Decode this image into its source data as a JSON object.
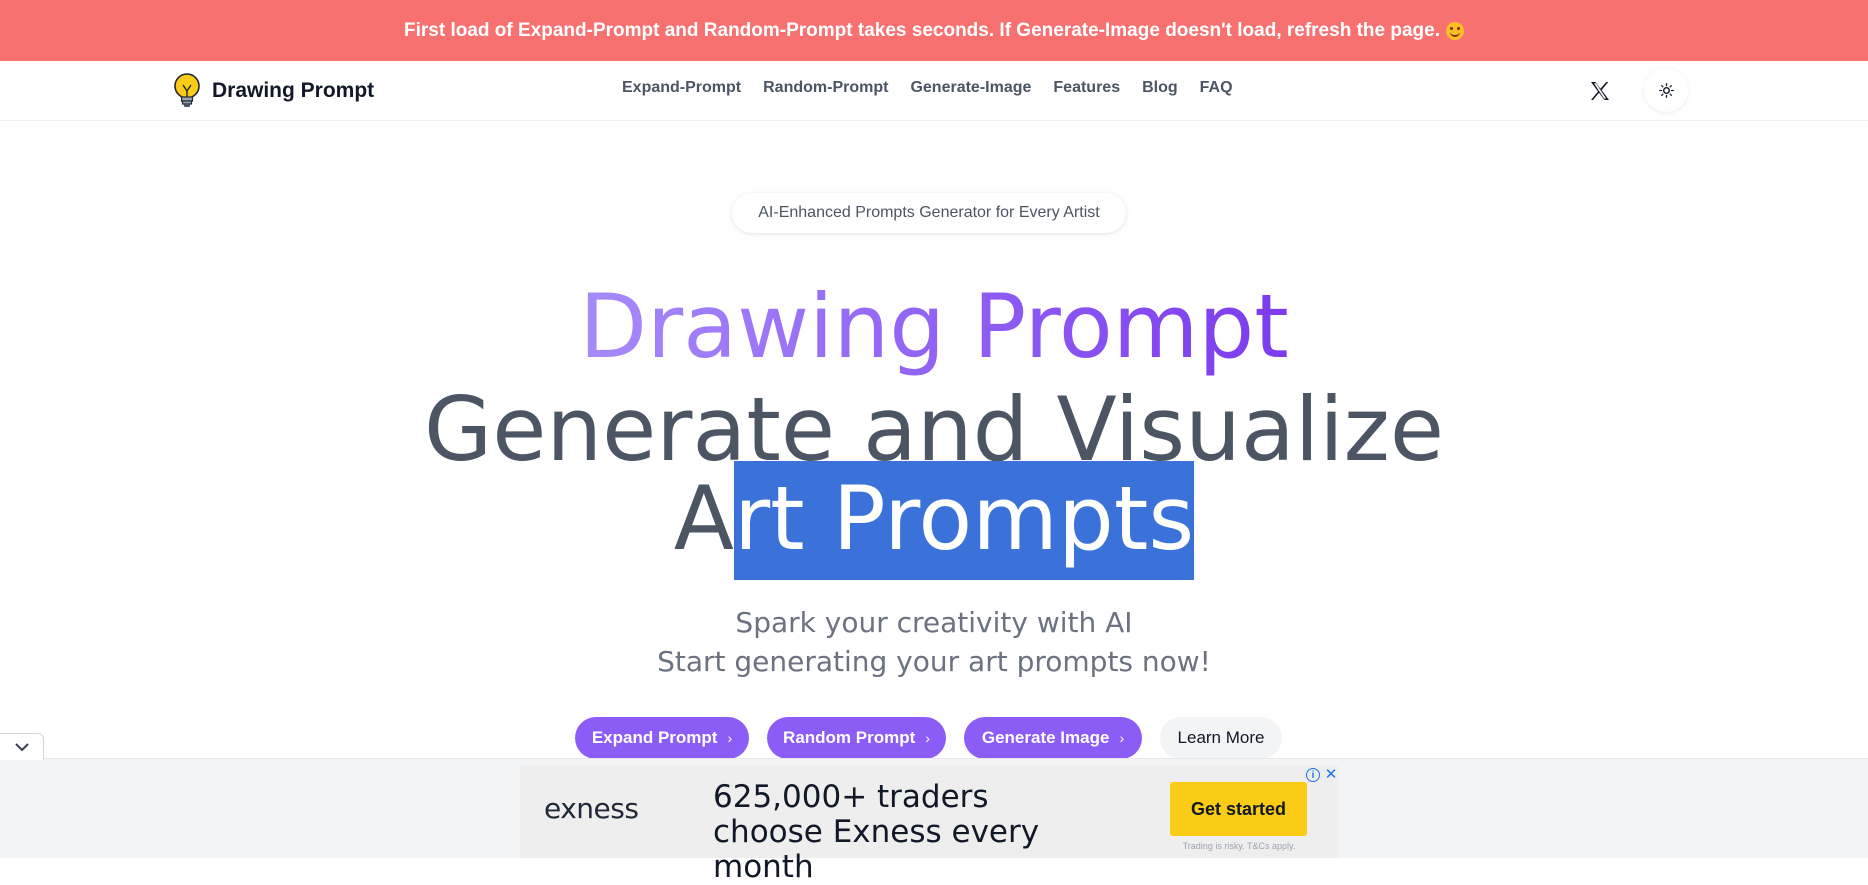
{
  "banner": {
    "text": "First load of Expand-Prompt and Random-Prompt takes seconds. If Generate-Image doesn't load, refresh the page.",
    "emoji_icon": "smiley-face-icon"
  },
  "header": {
    "logo_icon": "lightbulb-icon",
    "brand": "Drawing Prompt",
    "nav": [
      {
        "label": "Expand-Prompt"
      },
      {
        "label": "Random-Prompt"
      },
      {
        "label": "Generate-Image"
      },
      {
        "label": "Features"
      },
      {
        "label": "Blog"
      },
      {
        "label": "FAQ"
      }
    ],
    "x_icon": "x-twitter-icon",
    "theme_icon": "sun-icon"
  },
  "hero": {
    "tagline": "AI-Enhanced Prompts Generator for Every Artist",
    "title": "Drawing Prompt",
    "headline_line1": "Generate and Visualize",
    "headline_line2_a": "A",
    "headline_line2_b": "rt Prompts",
    "subtitle_line1": "Spark your creativity with AI",
    "subtitle_line2": "Start generating your art prompts now!",
    "buttons": [
      {
        "label": "Expand Prompt",
        "chevron": "›"
      },
      {
        "label": "Random Prompt",
        "chevron": "›"
      },
      {
        "label": "Generate Image",
        "chevron": "›"
      },
      {
        "label": "Learn More"
      }
    ]
  },
  "ad": {
    "collapse_icon": "chevron-down-icon",
    "brand": "exness",
    "headline": "625,000+ traders choose Exness every month",
    "cta": "Get started",
    "disclaimer": "Trading is risky. T&Cs apply.",
    "info_icon": "info-icon",
    "close_icon": "close-icon",
    "info_symbol": "i",
    "close_symbol": "✕"
  },
  "colors": {
    "banner_bg": "#f87171",
    "accent_purple": "#8b5cf6",
    "selection_blue": "#3b72d9",
    "ad_cta_yellow": "#facc15"
  }
}
